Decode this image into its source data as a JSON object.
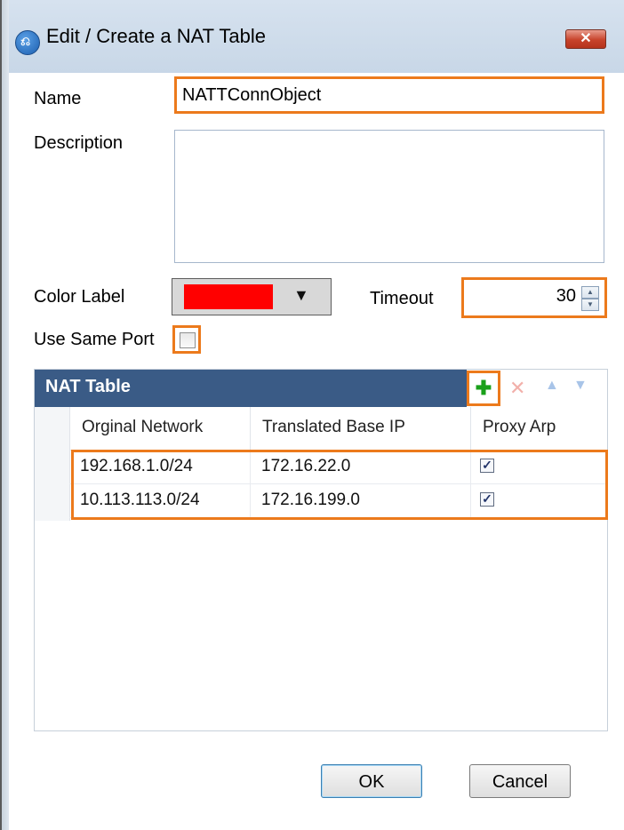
{
  "window": {
    "title": "Edit / Create a NAT Table",
    "close_glyph": "✕"
  },
  "form": {
    "name_label": "Name",
    "name_value": "NATTConnObject",
    "description_label": "Description",
    "description_value": "",
    "color_label": "Color Label",
    "color_value": "#ff0000",
    "timeout_label": "Timeout",
    "timeout_value": "30",
    "use_same_port_label": "Use Same Port",
    "use_same_port_checked": false
  },
  "nat_table": {
    "title": "NAT Table",
    "columns": [
      "Orginal Network",
      "Translated Base IP",
      "Proxy Arp"
    ],
    "rows": [
      {
        "original": "192.168.1.0/24",
        "translated": "172.16.22.0",
        "proxy_arp": true
      },
      {
        "original": "10.113.113.0/24",
        "translated": "172.16.199.0",
        "proxy_arp": true
      }
    ],
    "toolbar": {
      "add": "✚",
      "delete": "✕",
      "up": "▲",
      "down": "▼"
    }
  },
  "buttons": {
    "ok": "OK",
    "cancel": "Cancel"
  },
  "colors": {
    "highlight": "#ec7a1c",
    "grid_header": "#3a5b86"
  }
}
